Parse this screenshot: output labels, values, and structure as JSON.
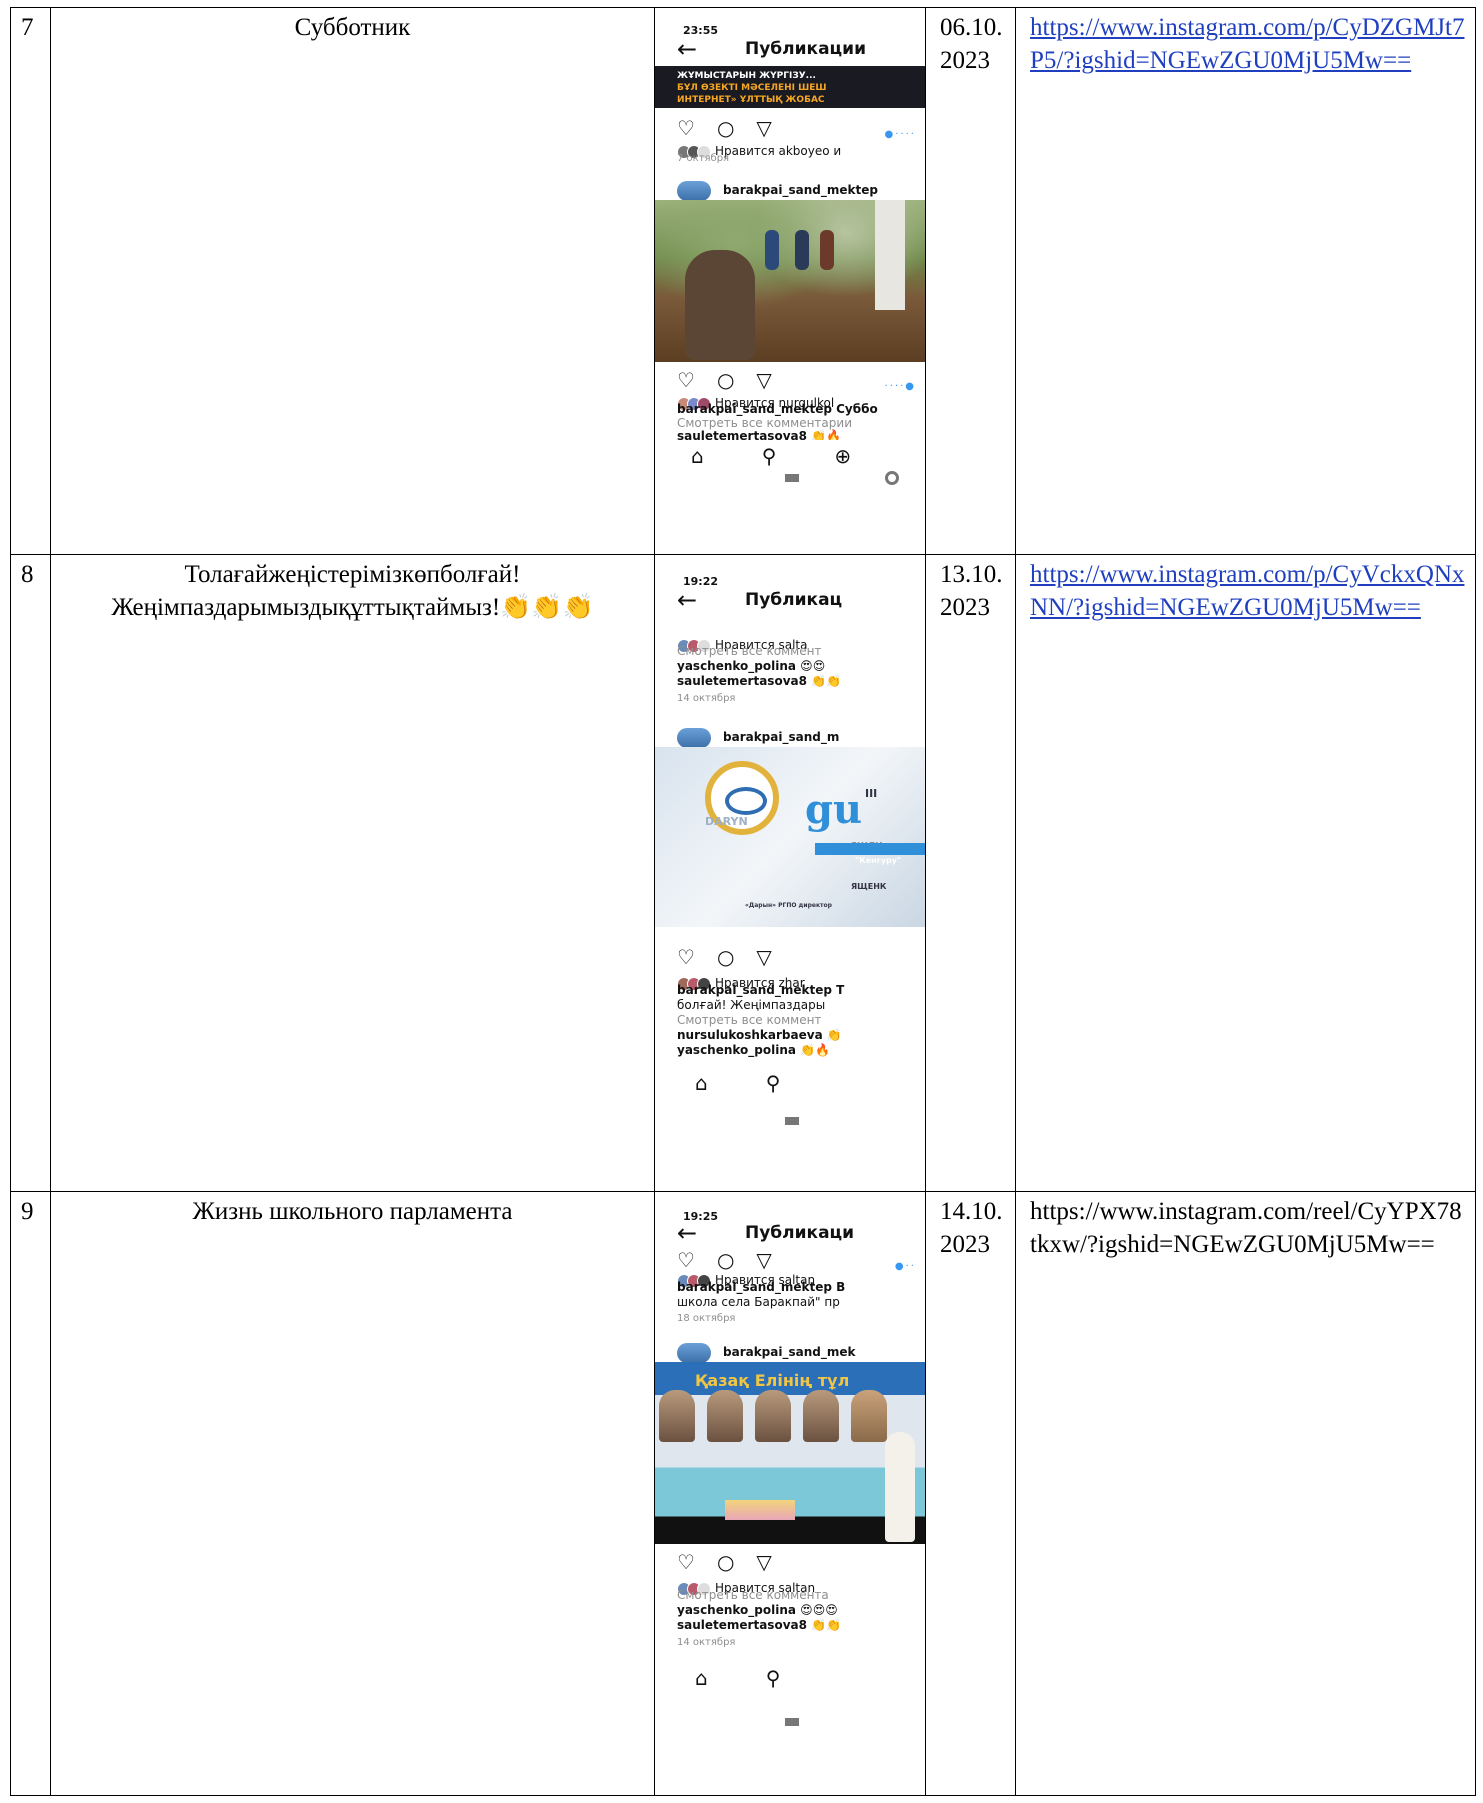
{
  "rows": [
    {
      "num": "7",
      "title": "Субботник",
      "date": "06.10.2023",
      "link": "https://www.instagram.com/p/CyDZGMJt7P5/?igshid=NGEwZGU0MjU5Mw==",
      "link_is_hyperlink": true,
      "phone": {
        "time": "23:55",
        "header": "Публикации",
        "banner_line1": "ЖҰМЫСТАРЫН ЖҮРГІЗУ...",
        "banner_line2": "БҰЛ ӨЗЕКТІ МӘСЕЛЕНІ ШЕШ",
        "banner_line3": "ИНТЕРНЕТ» ҰЛТТЫҚ ЖОБАС",
        "likes1": "Нравится akboyeo и",
        "date1": "7 октября",
        "author": "barakpai_sand_mektep",
        "likes2": "Нравится nurgulkol",
        "caption": "barakpai_sand_mektep Суббо",
        "comments": "Смотреть все комментарии",
        "commenter": "sauletemertasova8 👏🔥"
      }
    },
    {
      "num": "8",
      "title": "Толағайжеңістерімізкөпболғай! Жеңімпаздарымыздықұттықтаймыз!👏👏👏",
      "date": "13.10.2023",
      "link": "https://www.instagram.com/p/CyVckxQNxNN/?igshid=NGEwZGU0MjU5Mw==",
      "link_is_hyperlink": true,
      "phone": {
        "time": "19:22",
        "header": "Публикац",
        "likes1": "Нравится salta",
        "comments1": "Смотреть все коммент",
        "c1": "yaschenko_polina 😍😍",
        "c2": "sauletemertasova8 👏👏",
        "date1": "14 октября",
        "author": "barakpai_sand_m",
        "cert_daryn": "DARYN",
        "cert_roman": "III",
        "cert_name": "ЯЩЕН",
        "cert_kenguru": "\"Кенгуру\"",
        "cert_name2": "ЯЩЕНК",
        "cert_footer": "«Дарын» РГПО директор",
        "likes2": "Нравится zhar",
        "caption1": "barakpai_sand_mektep Т",
        "caption2": "болғай! Жеңімпаздары",
        "comments2": "Смотреть все коммент",
        "c3": "nursulukoshkarbaeva 👏",
        "c4": "yaschenko_polina 👏🔥"
      }
    },
    {
      "num": "9",
      "title": "Жизнь школьного парламента",
      "date": "14.10.2023",
      "link": "https://www.instagram.com/reel/CyYPX78tkxw/?igshid=NGEwZGU0MjU5Mw==",
      "link_is_hyperlink": false,
      "phone": {
        "time": "19:25",
        "header": "Публикаци",
        "likes1": "Нравится saltan",
        "caption1": "barakpai_sand_mektep В",
        "caption2": "школа села Баракпай\" пр",
        "date1": "18 октября",
        "author": "barakpai_sand_mek",
        "photo_title": "Қазақ Елінің тұл",
        "likes2": "Нравится saltan",
        "comments": "Смотреть все коммента",
        "c1": "yaschenko_polina 😍😍😍",
        "c2": "sauletemertasova8 👏👏",
        "date2": "14 октября"
      }
    }
  ],
  "colors": {
    "link": "#1f3fbf",
    "border": "#000000"
  },
  "icons": [
    "heart-icon",
    "comment-icon",
    "share-icon",
    "home-icon",
    "search-icon",
    "add-icon",
    "back-arrow-icon"
  ]
}
